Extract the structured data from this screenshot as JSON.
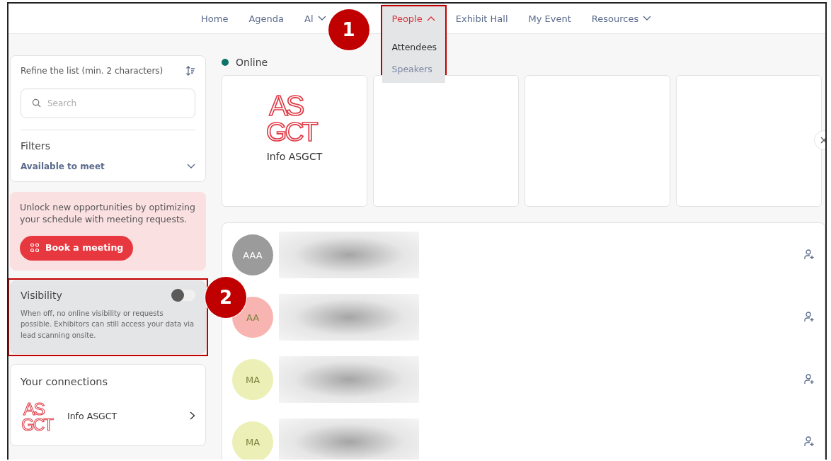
{
  "nav": {
    "items": [
      {
        "label": "Home",
        "selected": false
      },
      {
        "label": "Agenda",
        "selected": false
      },
      {
        "label": "Al",
        "selected": false,
        "has_menu": true,
        "expanded": false
      },
      {
        "label": "People",
        "selected": true,
        "has_menu": true,
        "expanded": true,
        "highlighted": true,
        "callout": "1",
        "dropdown": [
          {
            "label": "Attendees",
            "selected": true
          },
          {
            "label": "Speakers",
            "selected": false
          }
        ]
      },
      {
        "label": "Exhibit Hall",
        "selected": false
      },
      {
        "label": "My Event",
        "selected": false
      },
      {
        "label": "Resources",
        "selected": false,
        "has_menu": true,
        "expanded": false
      }
    ]
  },
  "sidebar": {
    "refine": {
      "label": "Refine the list (min. 2 characters)",
      "placeholder": "Search"
    },
    "filters": {
      "title": "Filters",
      "filter": "Available to meet"
    },
    "promo": {
      "text": "Unlock new opportunities by optimizing your schedule with meeting requests.",
      "button": "Book a meeting"
    },
    "visibility": {
      "title": "Visibility",
      "on": false,
      "description": "When off, no online visibility or requests possible. Exhibitors can still access your data via lead scanning onsite.",
      "highlighted": true,
      "callout": "2"
    },
    "connections": {
      "title": "Your connections",
      "items": [
        {
          "name": "Info ASGCT",
          "logo": [
            "AS",
            "GCT"
          ]
        }
      ]
    }
  },
  "main": {
    "status": {
      "label": "Online"
    },
    "cards": [
      {
        "kind": "exhibitor",
        "name": "Info ASGCT",
        "logo": [
          "AS",
          "GCT"
        ]
      },
      {
        "kind": "empty"
      },
      {
        "kind": "empty"
      },
      {
        "kind": "empty"
      }
    ],
    "people": [
      {
        "initials": "AAA",
        "color": "#9b9b9b"
      },
      {
        "initials": "AA",
        "color": "#f8b4b0"
      },
      {
        "initials": "MA",
        "color": "#ecf0b6"
      },
      {
        "initials": "MA",
        "color": "#ecf0b6"
      }
    ]
  }
}
